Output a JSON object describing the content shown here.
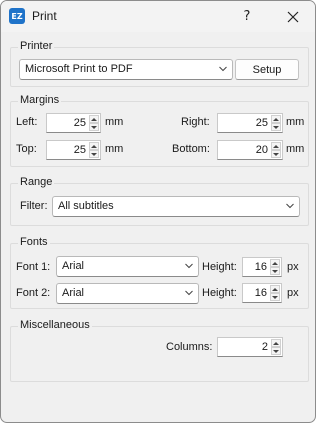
{
  "window": {
    "app_icon_text": "EZ",
    "title": "Print",
    "help_symbol": "?",
    "close_symbol": "✕"
  },
  "printer": {
    "group_label": "Printer",
    "selected": "Microsoft Print to PDF",
    "setup_label": "Setup"
  },
  "margins": {
    "group_label": "Margins",
    "left_label": "Left:",
    "left_value": "25",
    "left_unit": "mm",
    "right_label": "Right:",
    "right_value": "25",
    "right_unit": "mm",
    "top_label": "Top:",
    "top_value": "25",
    "top_unit": "mm",
    "bottom_label": "Bottom:",
    "bottom_value": "20",
    "bottom_unit": "mm"
  },
  "range": {
    "group_label": "Range",
    "filter_label": "Filter:",
    "filter_value": "All subtitles"
  },
  "fonts": {
    "group_label": "Fonts",
    "font1_label": "Font 1:",
    "font1_value": "Arial",
    "font1_height_label": "Height:",
    "font1_height_value": "16",
    "font1_unit": "px",
    "font2_label": "Font 2:",
    "font2_value": "Arial",
    "font2_height_label": "Height:",
    "font2_height_value": "16",
    "font2_unit": "px"
  },
  "misc": {
    "group_label": "Miscellaneous",
    "columns_label": "Columns:",
    "columns_value": "2"
  }
}
